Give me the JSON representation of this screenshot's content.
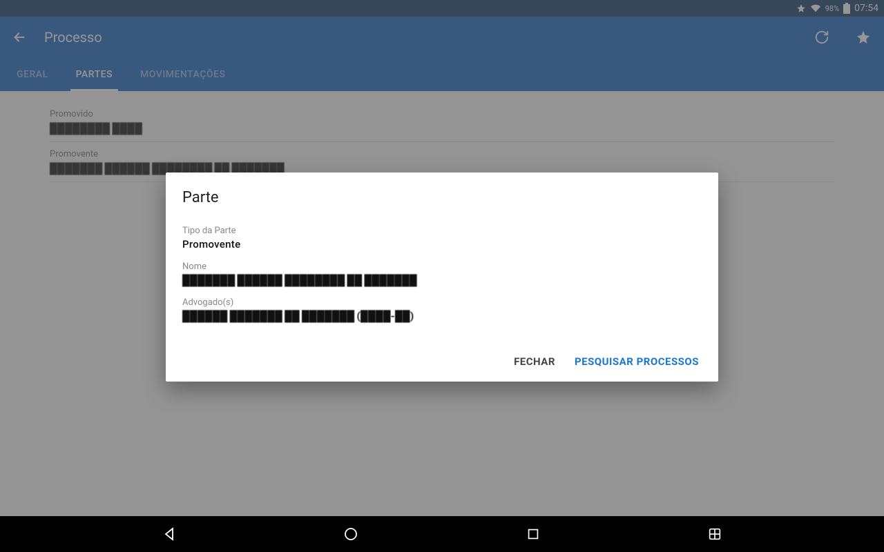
{
  "status": {
    "battery": "98%",
    "time": "07:54"
  },
  "toolbar": {
    "title": "Processo"
  },
  "tabs": [
    {
      "label": "GERAL",
      "active": false
    },
    {
      "label": "PARTES",
      "active": true
    },
    {
      "label": "MOVIMENTAÇÕES",
      "active": false
    }
  ],
  "parties": [
    {
      "label": "Promovido",
      "value": "████████ ████"
    },
    {
      "label": "Promovente",
      "value": "███████ ██████ ████████ ██ ███████"
    }
  ],
  "dialog": {
    "title": "Parte",
    "fields": [
      {
        "label": "Tipo da Parte",
        "value": "Promovente",
        "obscured": false
      },
      {
        "label": "Nome",
        "value": "███████ ██████ ████████ ██ ███████",
        "obscured": true
      },
      {
        "label": "Advogado(s)",
        "value": "██████ ███████ ██ ███████ (████-██)",
        "obscured": true
      }
    ],
    "actions": {
      "close": "FECHAR",
      "search": "PESQUISAR PROCESSOS"
    }
  }
}
